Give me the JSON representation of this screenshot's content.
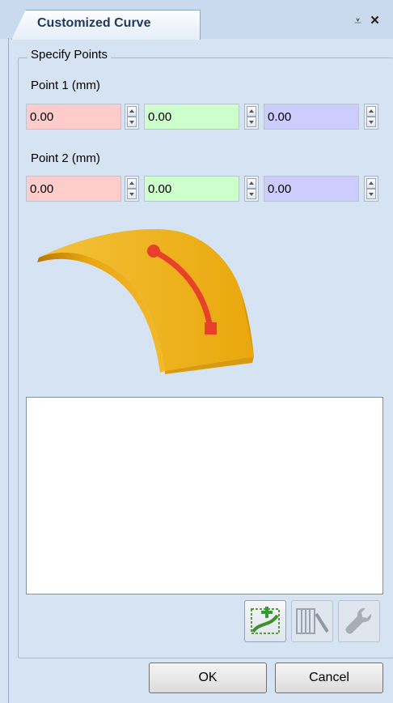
{
  "panel": {
    "title": "Customized Curve",
    "pin_glyph": "⩡",
    "close_glyph": "×"
  },
  "group": {
    "label": "Specify Points"
  },
  "points": [
    {
      "label": "Point 1 (mm)",
      "x": "0.00",
      "y": "0.00",
      "z": "0.00"
    },
    {
      "label": "Point 2 (mm)",
      "x": "0.00",
      "y": "0.00",
      "z": "0.00"
    }
  ],
  "preview": {
    "surface_color": "#f0b01c",
    "curve_color": "#e8402a"
  },
  "list": {
    "items": []
  },
  "toolbar": {
    "icons": [
      "add-curve-icon",
      "edit-columns-icon",
      "wrench-icon"
    ]
  },
  "buttons": {
    "ok": "OK",
    "cancel": "Cancel"
  }
}
